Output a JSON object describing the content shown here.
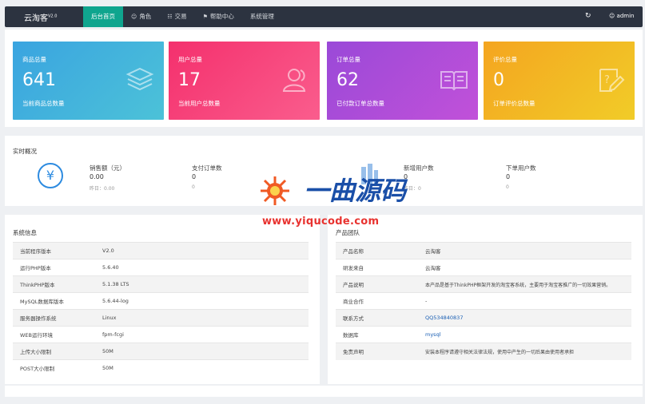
{
  "app": {
    "brand": "云淘客",
    "version": "V2.0"
  },
  "nav": [
    {
      "label": "后台首页",
      "icon": "",
      "active": true
    },
    {
      "label": "角色",
      "icon": "user-icon"
    },
    {
      "label": "交易",
      "icon": "sitemap-icon"
    },
    {
      "label": "帮助中心",
      "icon": "flag-icon"
    },
    {
      "label": "系统管理",
      "icon": ""
    }
  ],
  "topright": {
    "refresh_icon": "refresh-icon",
    "user": "admin"
  },
  "cards": [
    {
      "title": "商品总量",
      "value": "641",
      "desc": "当前商品总数量",
      "icon": "layers-icon",
      "color": "#3aa4e0"
    },
    {
      "title": "用户总量",
      "value": "17",
      "desc": "当前用户总数量",
      "icon": "users-icon",
      "color": "#f4306d"
    },
    {
      "title": "订单总量",
      "value": "62",
      "desc": "已付款订单总数量",
      "icon": "book-icon",
      "color": "#9a49d8"
    },
    {
      "title": "评价总量",
      "value": "0",
      "desc": "订单评价总数量",
      "icon": "edit-icon",
      "color": "#f4a520"
    }
  ],
  "realtime": {
    "title": "实时概况",
    "stats": [
      {
        "label": "销售额（元）",
        "value": "0.00",
        "sub": "昨日：0.00"
      },
      {
        "label": "支付订单数",
        "value": "0",
        "sub": "0"
      },
      {
        "label": "新增用户数",
        "value": "0",
        "sub": "昨日：0"
      },
      {
        "label": "下单用户数",
        "value": "0",
        "sub": "0"
      }
    ]
  },
  "sysinfo": {
    "title": "系统信息",
    "rows": [
      {
        "k": "当前程序版本",
        "v": "V2.0"
      },
      {
        "k": "运行PHP版本",
        "v": "5.6.40"
      },
      {
        "k": "ThinkPHP版本",
        "v": "5.1.38 LTS"
      },
      {
        "k": "MySQL数据库版本",
        "v": "5.6.44-log"
      },
      {
        "k": "服务器操作系统",
        "v": "Linux"
      },
      {
        "k": "WEB运行环境",
        "v": "fpm-fcgi"
      },
      {
        "k": "上传大小限制",
        "v": "50M"
      },
      {
        "k": "POST大小限制",
        "v": "50M"
      }
    ]
  },
  "team": {
    "title": "产品团队",
    "rows": [
      {
        "k": "产品名称",
        "v": "云淘客"
      },
      {
        "k": "研发来自",
        "v": "云淘客"
      },
      {
        "k": "产品说明",
        "v": "本产品是基于ThinkPHP框架开发的淘宝客系统，主要用于淘宝客推广的一切效果营销。"
      },
      {
        "k": "商业合作",
        "v": "-"
      },
      {
        "k": "联系方式",
        "v": "QQ534840837",
        "link": true
      },
      {
        "k": "数据库",
        "v": "mysql",
        "link": true
      },
      {
        "k": "免责声明",
        "v": "安装本程序请遵守相关法律法规，使用中产生的一切后果由使用者承担"
      }
    ]
  },
  "watermark": {
    "cn": "一曲源码",
    "url": "www.yiqucode.com"
  }
}
